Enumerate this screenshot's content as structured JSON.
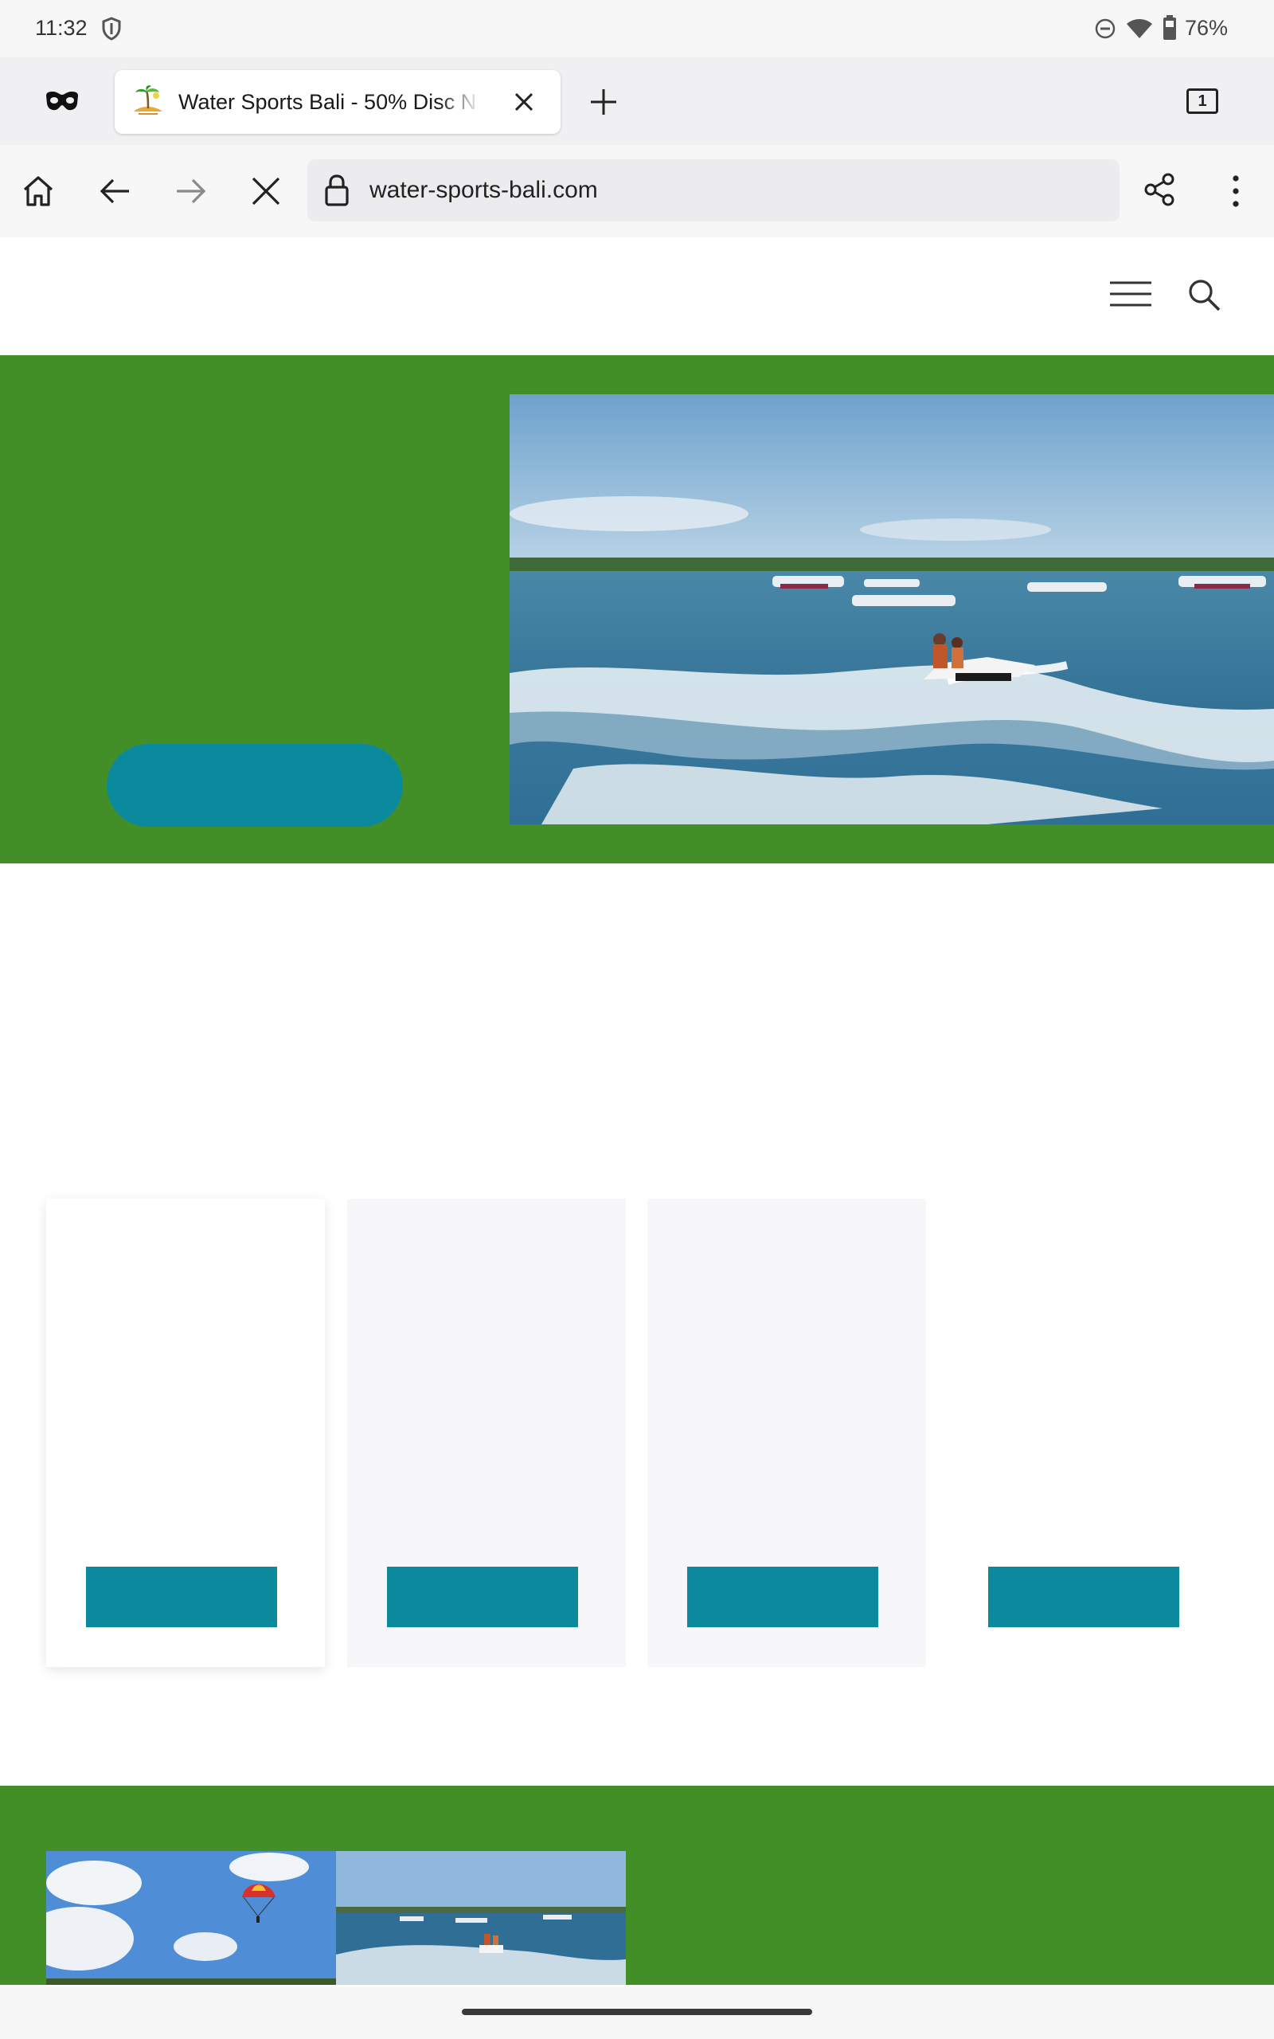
{
  "status_bar": {
    "time": "11:32",
    "battery": "76%",
    "icons": [
      "shield-icon",
      "do-not-disturb-icon",
      "wifi-icon",
      "battery-icon"
    ]
  },
  "tabs": {
    "active_tab_title": "Water Sports Bali - 50% Disc N",
    "tab_count": "1",
    "icons": [
      "incognito-mask-icon",
      "favicon-icon",
      "close-tab-icon",
      "new-tab-plus-icon",
      "tab-switcher-icon"
    ]
  },
  "toolbar": {
    "url": "water-sports-bali.com",
    "icons": [
      "home-icon",
      "back-arrow-icon",
      "forward-arrow-icon",
      "stop-loading-icon",
      "lock-icon",
      "share-icon",
      "more-menu-icon"
    ]
  },
  "site_header": {
    "icons": [
      "hamburger-menu-icon",
      "search-icon"
    ]
  },
  "colors": {
    "brand_green": "#438f27",
    "button_teal": "#0b8a9e",
    "card_gray": "#f7f7f9"
  },
  "hero": {
    "photo": "jet-ski on sea with boats"
  },
  "cards": [
    {
      "style": "shadowed"
    },
    {
      "style": "gray"
    },
    {
      "style": "gray"
    },
    {
      "style": "plain"
    }
  ]
}
